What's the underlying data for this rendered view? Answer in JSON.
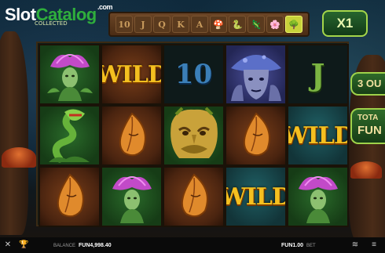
{
  "brand": {
    "slot": "Slot",
    "catalog": "Catalog",
    "com": ".com"
  },
  "collected_label": "COLLECTED",
  "symbol_strip": [
    "10",
    "J",
    "Q",
    "K",
    "A",
    "🍄",
    "🐍",
    "🦎",
    "🌸",
    "🌳"
  ],
  "multiplier": "X1",
  "side": {
    "spins_text": "3 OU",
    "total_label": "TOTA",
    "total_value": "FUN"
  },
  "reels": [
    [
      "flower-fairy",
      "snake-plant",
      "wood-leaf"
    ],
    [
      "wild",
      "wood-leaf",
      "flower-fairy"
    ],
    [
      "ten",
      "tree-face",
      "wood-leaf"
    ],
    [
      "mushroom-face",
      "wood-leaf",
      "wild"
    ],
    [
      "j",
      "wild",
      "flower-fairy"
    ]
  ],
  "symbols": {
    "wild": "WILD",
    "ten": "10",
    "j": "J"
  },
  "bottom": {
    "balance_label": "BALANCE",
    "balance_value": "FUN4,998.40",
    "bet_value": "FUN1.00",
    "bet_label": "BET"
  },
  "colors": {
    "wild_gold": "#f4c020",
    "accent_green": "#9fd24a"
  }
}
